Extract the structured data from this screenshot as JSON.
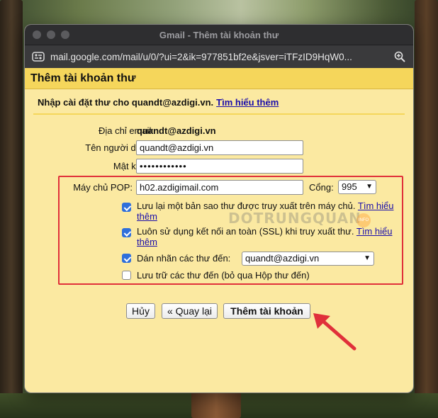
{
  "window": {
    "title": "Gmail - Thêm tài khoản thư",
    "url": "mail.google.com/mail/u/0/?ui=2&ik=977851bf2e&jsver=iTFzID9HqW0..."
  },
  "page": {
    "heading": "Thêm tài khoản thư",
    "intro_text": "Nhập cài đặt thư cho quandt@azdigi.vn.",
    "learn_more": "Tìm hiểu thêm"
  },
  "form": {
    "email_label": "Địa chỉ email:",
    "email_value": "quandt@azdigi.vn",
    "username_label": "Tên người dùng:",
    "username_value": "quandt@azdigi.vn",
    "password_label": "Mật khẩu:",
    "password_value": "••••••••••••",
    "pop_label": "Máy chủ POP:",
    "pop_value": "h02.azdigimail.com",
    "port_label": "Cổng:",
    "port_value": "995",
    "options": [
      {
        "text": "Lưu lại một bản sao thư được truy xuất trên máy chủ.",
        "link": "Tìm hiểu thêm",
        "checked": true
      },
      {
        "text": "Luôn sử dụng kết nối an toàn (SSL) khi truy xuất thư.",
        "link": "Tìm hiểu thêm",
        "checked": true
      },
      {
        "text": "Dán nhãn các thư đến:",
        "checked": true
      },
      {
        "text": "Lưu trữ các thư đến (bỏ qua Hộp thư đến)",
        "checked": false
      }
    ],
    "label_select_value": "quandt@azdigi.vn"
  },
  "buttons": {
    "cancel": "Hủy",
    "back": "« Quay lại",
    "add": "Thêm tài khoản"
  },
  "watermark": {
    "text": "DOTRUNGQUAN",
    "badge": "INFO"
  },
  "colors": {
    "header_yellow": "#f5d65b",
    "panel_bg": "#fbe9a1",
    "highlight_red": "#e0303a",
    "link_blue": "#1a0dab",
    "checkbox_blue": "#2f6fdb"
  },
  "icons": {
    "url": "site-settings-icon",
    "zoom": "zoom-icon",
    "pointer": "arrow-pointer-icon"
  }
}
